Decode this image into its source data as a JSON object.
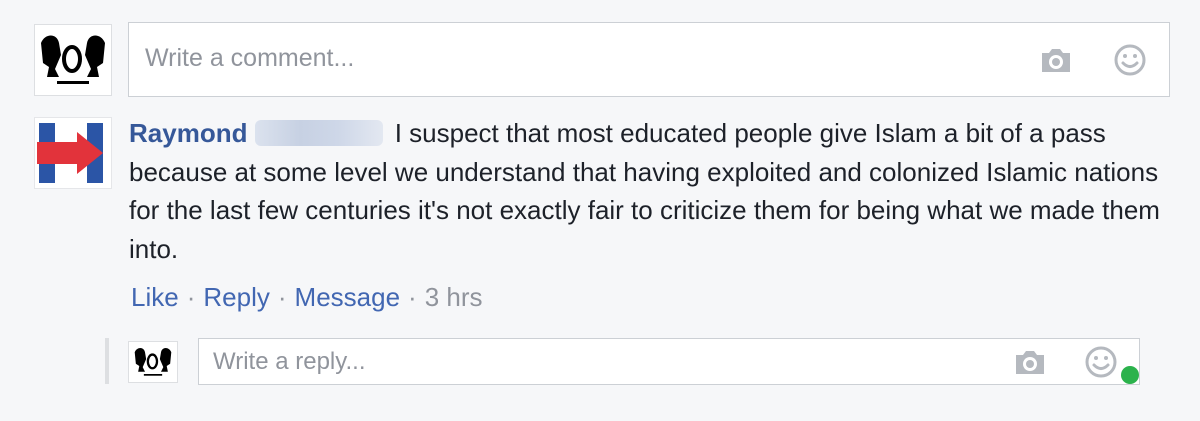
{
  "composer": {
    "placeholder": "Write a comment..."
  },
  "comment": {
    "author": "Raymond",
    "text": "I suspect that most educated people give Islam a bit of a pass because at some level we understand that having exploited and colonized Islamic nations for the last few centuries it's not exactly fair to criticize them for being what we made them into.",
    "actions": {
      "like": "Like",
      "reply": "Reply",
      "message": "Message",
      "separator": "·",
      "time": "3 hrs"
    }
  },
  "reply_composer": {
    "placeholder": "Write a reply..."
  },
  "icons": {
    "camera": "camera-icon",
    "emoji": "emoji-icon",
    "presence": "online-status-dot"
  },
  "colors": {
    "link": "#4267b2",
    "author": "#365899",
    "presence": "#2bb24c",
    "logo_red": "#e2333b",
    "logo_blue": "#2b55a6"
  }
}
